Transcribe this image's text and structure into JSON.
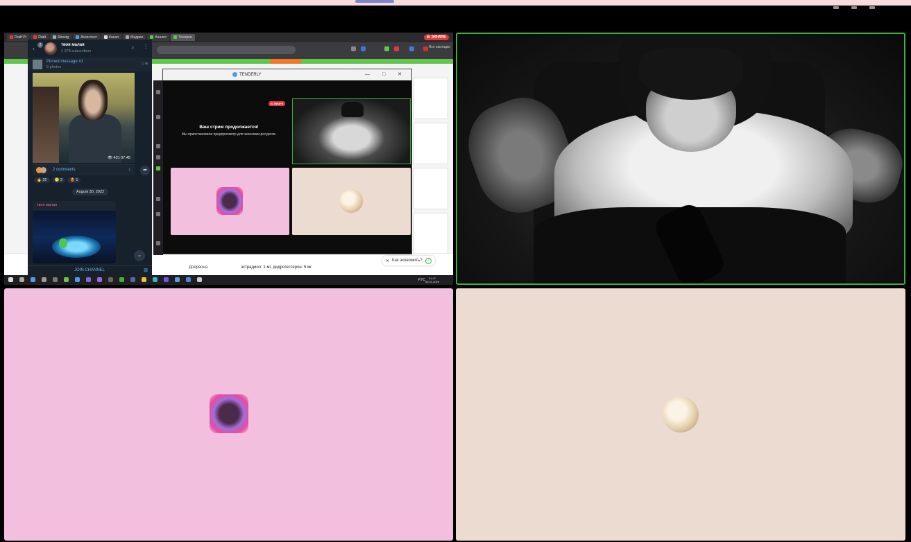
{
  "browser": {
    "tabs": [
      "Draft Pr",
      "Draft",
      "Streetg",
      "Ассистент",
      "Канал",
      "Мадрин",
      "Аналит",
      "Тенерли"
    ],
    "live_badge": "В ЭФИРЕ",
    "bookmarks_label": "Все закладки"
  },
  "tenderly": {
    "title": "TENDERLY",
    "live_badge": "В ЭФИРЕ",
    "message_title": "Ваш стрим продолжается!",
    "message_body": "Мы приостановили предпросмотр для экономии ресурсов.",
    "controls": "— □ ✕"
  },
  "telegram": {
    "channel_name": "твоя малая",
    "subscribers": "1 078 subscribers",
    "unread_badge": "2",
    "pinned_title": "Pinned message #1",
    "pinned_subtitle": "5 photos",
    "views": "👁 421  07:45",
    "comments": "2 comments",
    "reactions": [
      "🔥 22",
      "😁 2",
      "❤️‍🔥 1"
    ],
    "date": "August 30, 2022",
    "second_author": "твоя малая",
    "join": "JOIN CHANNEL"
  },
  "page": {
    "footer_left": "Доярвона",
    "footer_right": "эстрадиол: 1 мг, дидрогестерон: 5 мг",
    "economy_prompt": "Как экономить?"
  },
  "taskbar": {
    "lang": "РУС",
    "time": "01:47",
    "date": "08.01.2025"
  },
  "colors": {
    "active_speaker_border": "#3cb043",
    "pink_tile": "#f2c0de",
    "beige_tile": "#ebdbd0",
    "live_red": "#e53935"
  }
}
